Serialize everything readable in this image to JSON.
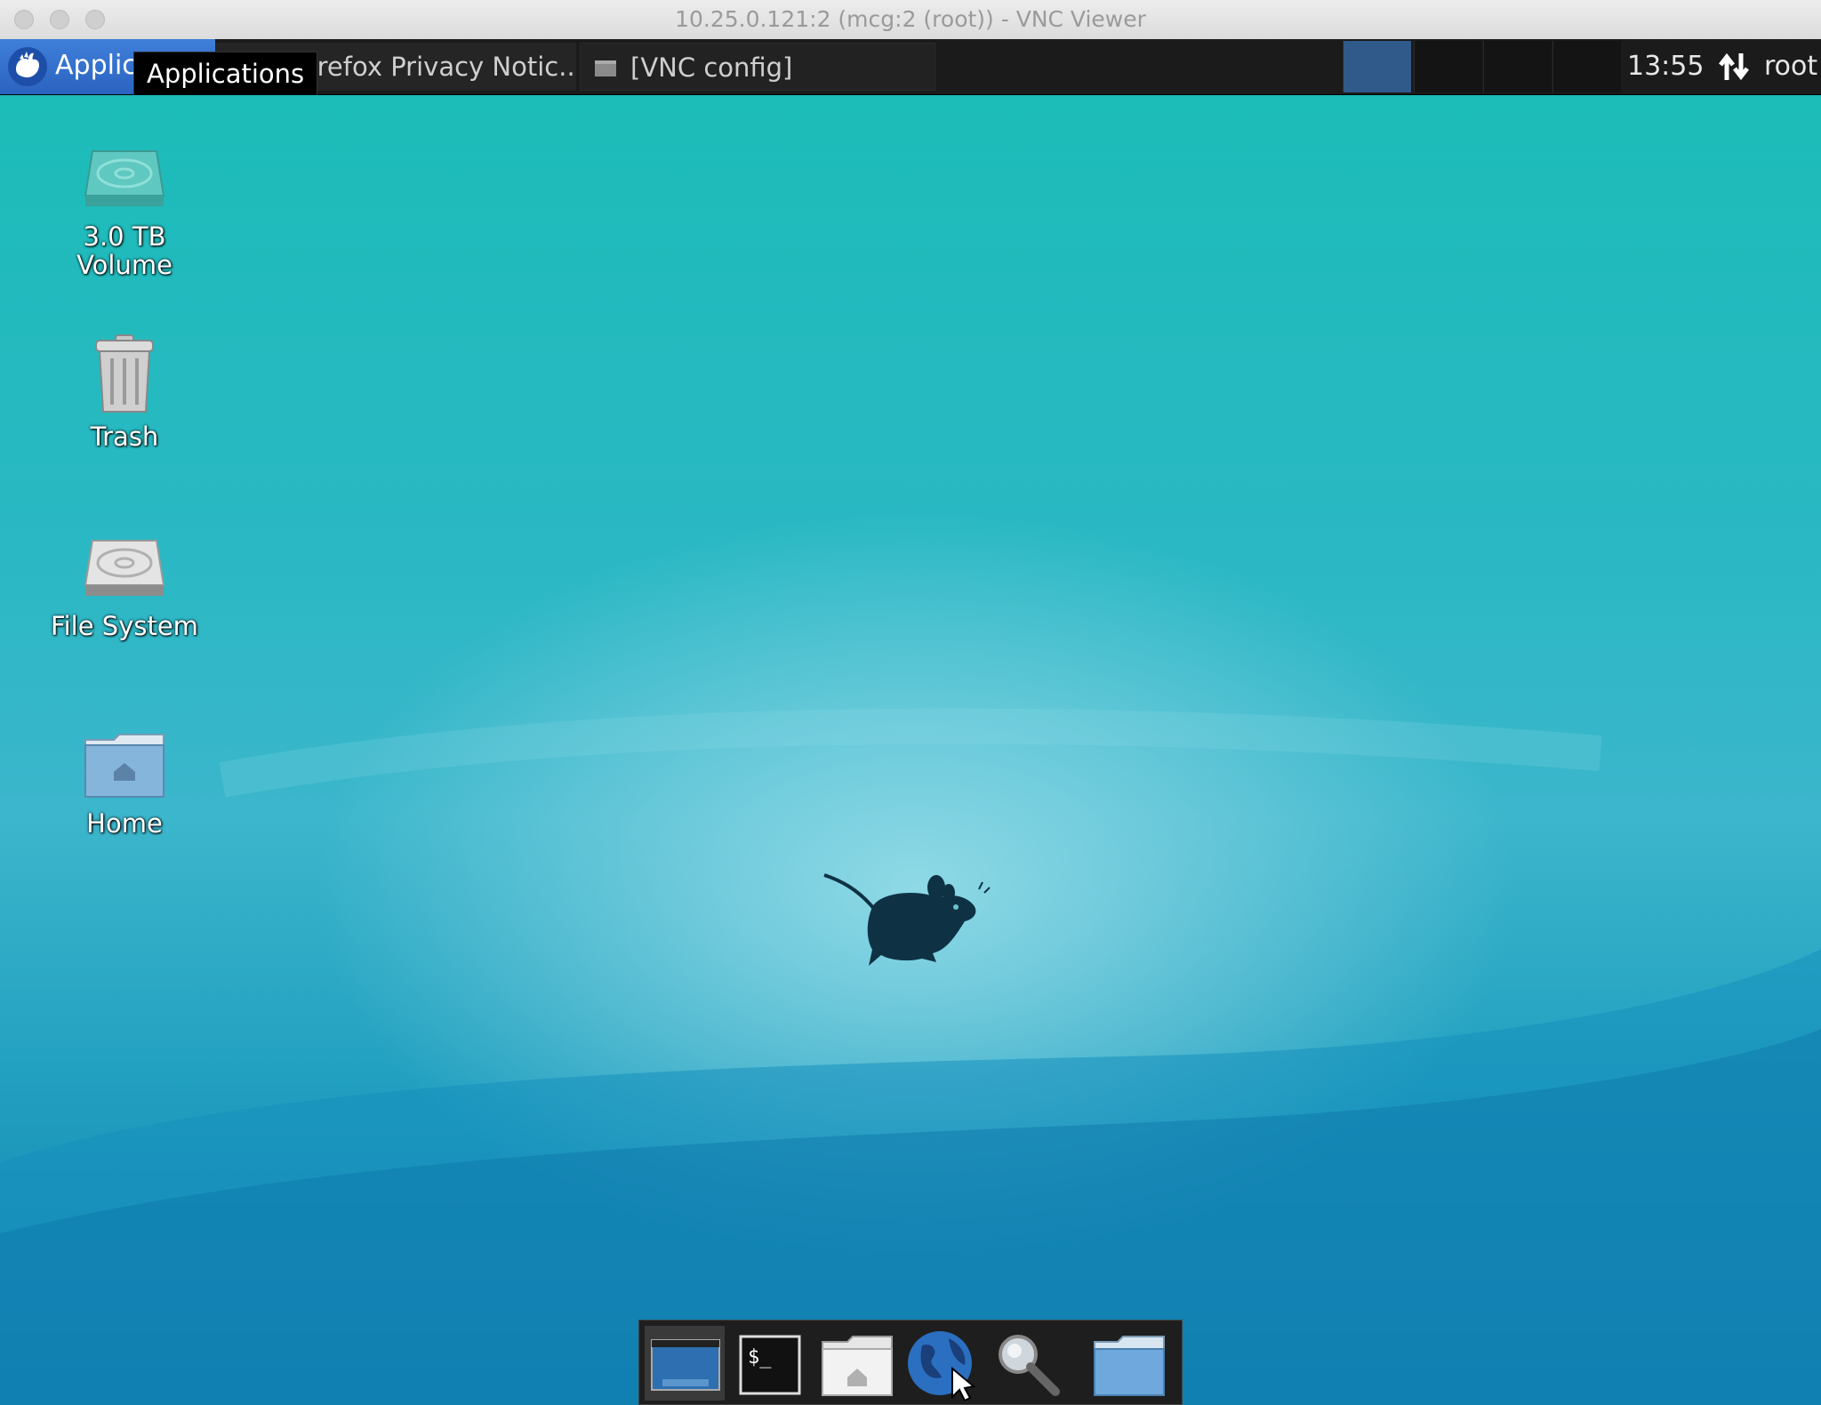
{
  "window": {
    "title": "10.25.0.121:2 (mcg:2 (root)) - VNC Viewer"
  },
  "panel": {
    "app_menu_label": "Applic",
    "tooltip": "Applications",
    "tasks": [
      {
        "label": "Firefox Privacy Notic..."
      },
      {
        "label": "[VNC config]"
      }
    ],
    "workspaces": 4,
    "active_workspace": 1,
    "clock": "13:55",
    "user": "root"
  },
  "desktop": {
    "icons": [
      {
        "line1": "3.0 TB",
        "line2": "Volume",
        "icon": "hard-drive-icon"
      },
      {
        "line1": "Trash",
        "icon": "trash-icon"
      },
      {
        "line1": "File System",
        "icon": "file-system-icon"
      },
      {
        "line1": "Home",
        "icon": "home-folder-icon"
      }
    ]
  },
  "dock": {
    "items": [
      {
        "icon": "show-desktop-icon"
      },
      {
        "icon": "terminal-icon"
      },
      {
        "icon": "file-manager-icon"
      },
      {
        "icon": "web-browser-icon"
      },
      {
        "icon": "app-finder-icon"
      },
      {
        "icon": "folder-icon"
      }
    ]
  }
}
